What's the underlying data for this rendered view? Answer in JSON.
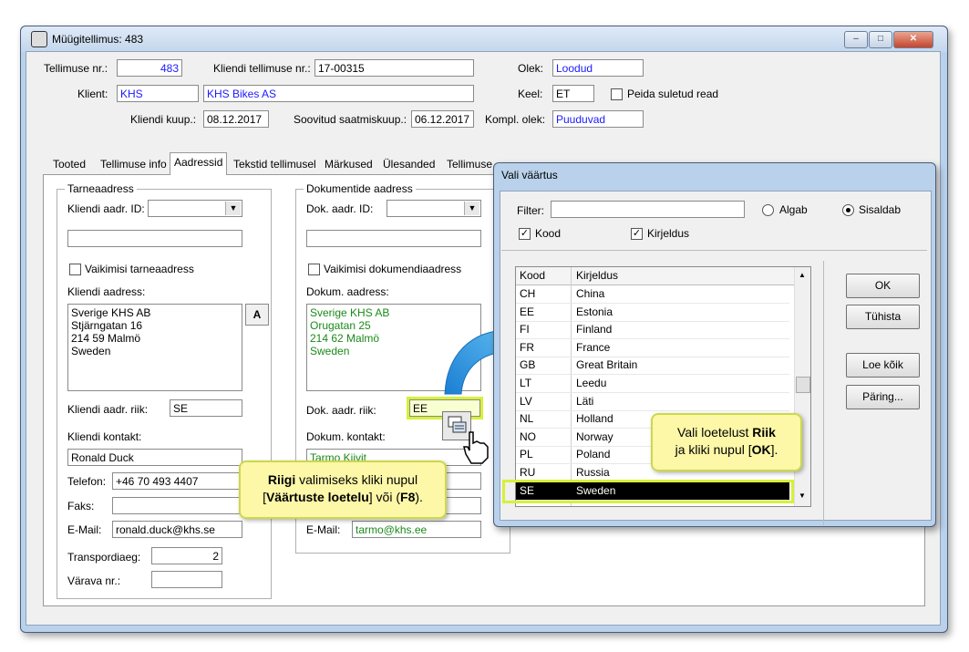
{
  "window": {
    "title": "Müügitellimus: 483",
    "controls": [
      "minimize",
      "maximize",
      "close"
    ]
  },
  "header": {
    "order_no_label": "Tellimuse nr.:",
    "order_no": "483",
    "client_order_no_label": "Kliendi tellimuse nr.:",
    "client_order_no": "17-00315",
    "status_label": "Olek:",
    "status": "Loodud",
    "client_label": "Klient:",
    "client_code": "KHS",
    "client_name": "KHS Bikes AS",
    "language_label": "Keel:",
    "language": "ET",
    "hide_closed_label": "Peida suletud read",
    "client_date_label": "Kliendi kuup.:",
    "client_date": "08.12.2017",
    "desired_delivery_label": "Soovitud saatmiskuup.:",
    "desired_delivery": "06.12.2017",
    "complete_status_label": "Kompl. olek:",
    "complete_status": "Puuduvad"
  },
  "tabs": [
    "Tooted",
    "Tellimuse info",
    "Aadressid",
    "Tekstid tellimusel",
    "Märkused",
    "Ülesanded",
    "Tellimuse"
  ],
  "active_tab": "Aadressid",
  "delivery": {
    "group_title": "Tarneaadress",
    "addr_id_label": "Kliendi aadr. ID:",
    "default_label": "Vaikimisi tarneaadress",
    "address_label": "Kliendi aadress:",
    "address": "Sverige KHS AB\nStjärngatan 16\n214 59 Malmö\nSweden",
    "a_button": "A",
    "country_label": "Kliendi aadr. riik:",
    "country": "SE",
    "contact_label": "Kliendi kontakt:",
    "contact": "Ronald Duck",
    "phone_label": "Telefon:",
    "phone": "+46 70 493 4407",
    "fax_label": "Faks:",
    "email_label": "E-Mail:",
    "email": "ronald.duck@khs.se",
    "transport_label": "Transpordiaeg:",
    "transport": "2",
    "gate_label": "Värava nr.:"
  },
  "documents": {
    "group_title": "Dokumentide aadress",
    "addr_id_label": "Dok. aadr. ID:",
    "default_label": "Vaikimisi dokumendiaadress",
    "address_label": "Dokum. aadress:",
    "address": "Sverige KHS AB\nOrugatan 25\n214 62 Malmö\nSweden",
    "country_label": "Dok. aadr. riik:",
    "country": "EE",
    "contact_label": "Dokum. kontakt:",
    "contact": "Tarmo Kiivit",
    "email_label": "E-Mail:",
    "email": "tarmo@khs.ee"
  },
  "dialog": {
    "title": "Vali väärtus",
    "filter_label": "Filter:",
    "radio_starts": "Algab",
    "radio_contains": "Sisaldab",
    "chk_code": "Kood",
    "chk_desc": "Kirjeldus",
    "col_code": "Kood",
    "col_desc": "Kirjeldus",
    "buttons": {
      "ok": "OK",
      "cancel": "Tühista",
      "load_all": "Loe kõik",
      "query": "Päring..."
    },
    "rows": [
      {
        "code": "CH",
        "desc": "China"
      },
      {
        "code": "EE",
        "desc": "Estonia"
      },
      {
        "code": "FI",
        "desc": "Finland"
      },
      {
        "code": "FR",
        "desc": "France"
      },
      {
        "code": "GB",
        "desc": "Great Britain"
      },
      {
        "code": "LT",
        "desc": "Leedu"
      },
      {
        "code": "LV",
        "desc": "Läti"
      },
      {
        "code": "NL",
        "desc": "Holland"
      },
      {
        "code": "NO",
        "desc": "Norway"
      },
      {
        "code": "PL",
        "desc": "Poland"
      },
      {
        "code": "RU",
        "desc": "Russia"
      },
      {
        "code": "SE",
        "desc": "Sweden"
      }
    ],
    "selected_code": "SE"
  },
  "callouts": {
    "left_bold1": "Riigi",
    "left_text1": " valimiseks kliki nupul",
    "left_text2a": "[",
    "left_bold2": "Väärtuste loetelu",
    "left_text2b": "] või (",
    "left_bold3": "F8",
    "left_text2c": ").",
    "right_text1": "Vali loetelust ",
    "right_bold1": "Riik",
    "right_text2": "ja kliki nupul [",
    "right_bold2": "OK",
    "right_text3": "]."
  },
  "colors": {
    "accent": "#1a1aff",
    "green_text": "#1a8a1a",
    "callout_bg": "#fdf7a8",
    "highlight": "#d7f03a"
  }
}
